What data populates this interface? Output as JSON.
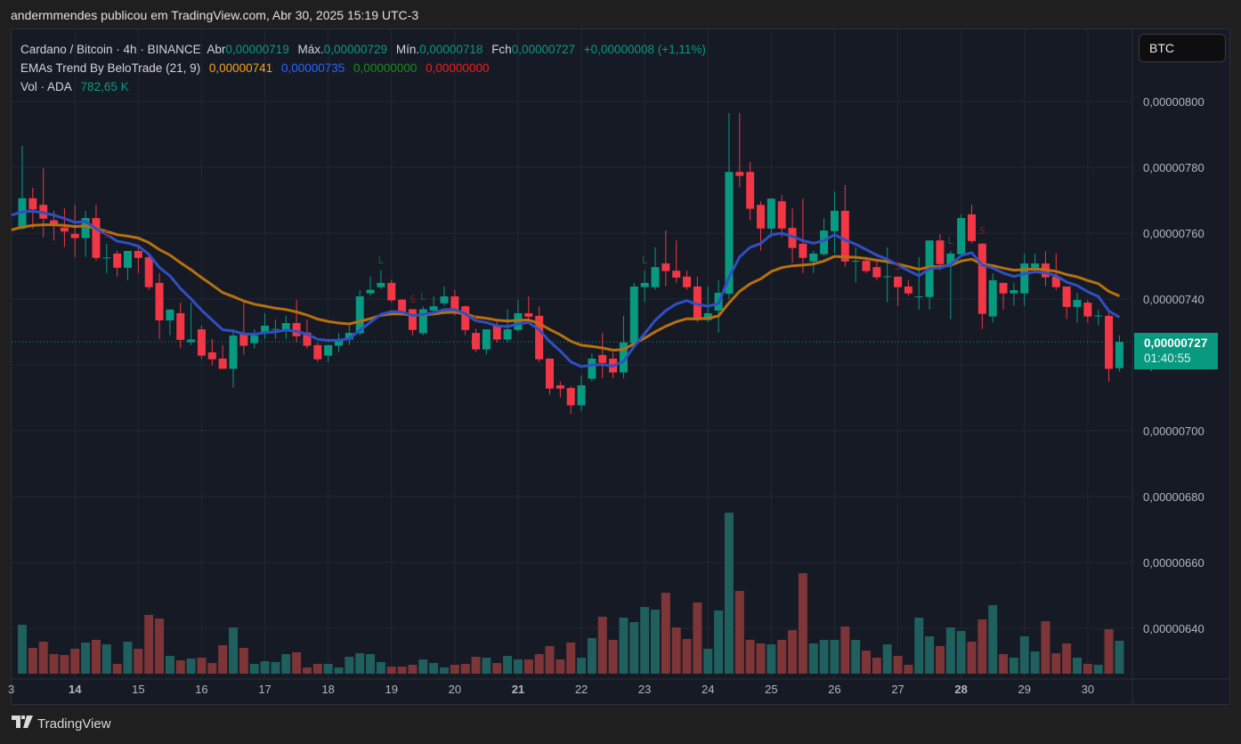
{
  "post_header": "andermmendes publicou em TradingView.com, Abr 30, 2025 15:19 UTC-3",
  "legend": {
    "symbol": "Cardano / Bitcoin · 4h · BINANCE",
    "open_label": "Abr",
    "open": "0,00000719",
    "high_label": "Máx.",
    "high": "0,00000729",
    "low_label": "Mín.",
    "low": "0,00000718",
    "close_label": "Fch",
    "close": "0,00000727",
    "change": "+0,00000008 (+1,11%)",
    "indicator": "EMAs Trend By BeloTrade (21, 9)",
    "ema_values": [
      "0,00000741",
      "0,00000735",
      "0,00000000",
      "0,00000000"
    ],
    "volume_label": "Vol · ADA",
    "volume_value": "782,65 K"
  },
  "currency_button": "BTC",
  "price_label": {
    "value": "0,00000727",
    "countdown": "01:40:55"
  },
  "footer_logo": "TradingView",
  "colors": {
    "up": "#089981",
    "down": "#f23645",
    "volume_up": "#1f5f5e",
    "volume_down": "#7e3538",
    "ema_fast": "#2f4fc4",
    "ema_slow": "#b8700f",
    "signal_long": "#0f6d1c",
    "signal_short": "#8e1b1b"
  },
  "chart_data": {
    "type": "candlestick",
    "title": "Cardano / Bitcoin · 4h · BINANCE",
    "unit_note": "prices in 1e-8 BTC (727 = 0,00000727)",
    "ylim": [
      630,
      820
    ],
    "y_ticks": [
      {
        "value": 800,
        "label": "0,00000800"
      },
      {
        "value": 780,
        "label": "0,00000780"
      },
      {
        "value": 760,
        "label": "0,00000760"
      },
      {
        "value": 740,
        "label": "0,00000740"
      },
      {
        "value": 720,
        "label": "0,00000720"
      },
      {
        "value": 700,
        "label": "0,00000700"
      },
      {
        "value": 680,
        "label": "0,00000680"
      },
      {
        "value": 660,
        "label": "0,00000660"
      },
      {
        "value": 640,
        "label": "0,00000640"
      }
    ],
    "x_ticks": [
      {
        "candle": 0,
        "label": "3",
        "bold": false
      },
      {
        "candle": 6,
        "label": "14",
        "bold": true
      },
      {
        "candle": 12,
        "label": "15",
        "bold": false
      },
      {
        "candle": 18,
        "label": "16",
        "bold": false
      },
      {
        "candle": 24,
        "label": "17",
        "bold": false
      },
      {
        "candle": 30,
        "label": "18",
        "bold": false
      },
      {
        "candle": 36,
        "label": "19",
        "bold": false
      },
      {
        "candle": 42,
        "label": "20",
        "bold": false
      },
      {
        "candle": 48,
        "label": "21",
        "bold": true
      },
      {
        "candle": 54,
        "label": "22",
        "bold": false
      },
      {
        "candle": 60,
        "label": "23",
        "bold": false
      },
      {
        "candle": 66,
        "label": "24",
        "bold": false
      },
      {
        "candle": 72,
        "label": "25",
        "bold": false
      },
      {
        "candle": 78,
        "label": "26",
        "bold": false
      },
      {
        "candle": 84,
        "label": "27",
        "bold": false
      },
      {
        "candle": 90,
        "label": "28",
        "bold": true
      },
      {
        "candle": 96,
        "label": "29",
        "bold": false
      },
      {
        "candle": 102,
        "label": "30",
        "bold": false
      }
    ],
    "candle_fields": [
      "open",
      "high",
      "low",
      "close",
      "volume_k"
    ],
    "candles": [
      [
        761.4,
        786.5,
        761,
        770.6,
        1163
      ],
      [
        770.6,
        773.8,
        761.4,
        767.2,
        613
      ],
      [
        768.6,
        779.7,
        758.7,
        764.4,
        761
      ],
      [
        763.9,
        766.8,
        757.8,
        762.5,
        465
      ],
      [
        761.7,
        767.6,
        755.8,
        760.5,
        444
      ],
      [
        759.8,
        768.6,
        752.8,
        758.5,
        592
      ],
      [
        758.5,
        766.8,
        752.8,
        764.6,
        740
      ],
      [
        764.6,
        768.6,
        751.7,
        752.5,
        804
      ],
      [
        752.5,
        756.8,
        747.9,
        752.6,
        698
      ],
      [
        753.8,
        754.7,
        746.8,
        749.5,
        233
      ],
      [
        749.5,
        754.6,
        745.8,
        754.6,
        761
      ],
      [
        754.6,
        755.8,
        747.9,
        752.5,
        592
      ],
      [
        752.7,
        753.8,
        742.8,
        743.6,
        1396
      ],
      [
        744.9,
        747.9,
        727.9,
        733.5,
        1311
      ],
      [
        733.5,
        736.8,
        729,
        736.8,
        423
      ],
      [
        735.7,
        738.9,
        725,
        727.6,
        317
      ],
      [
        726.9,
        738.9,
        726,
        727.7,
        360
      ],
      [
        730.8,
        731.9,
        721.8,
        722.8,
        381
      ],
      [
        723.8,
        727.9,
        719.8,
        721.7,
        254
      ],
      [
        721.9,
        726,
        718.8,
        718.8,
        677
      ],
      [
        718.8,
        730.8,
        713.1,
        728.9,
        1100
      ],
      [
        729.7,
        738.9,
        723.1,
        725.8,
        613
      ],
      [
        726.6,
        730.8,
        725,
        728.9,
        233
      ],
      [
        729.5,
        735.7,
        727.9,
        731.9,
        296
      ],
      [
        730.8,
        733.8,
        727.9,
        730.9,
        275
      ],
      [
        730.7,
        734.9,
        727.9,
        732.7,
        465
      ],
      [
        732.7,
        739.7,
        726.8,
        728.7,
        508
      ],
      [
        729.8,
        733.8,
        725,
        725.8,
        148
      ],
      [
        726,
        726.8,
        720.9,
        721.7,
        233
      ],
      [
        722.8,
        726,
        720.9,
        726,
        233
      ],
      [
        725.8,
        729.7,
        723.9,
        727.8,
        148
      ],
      [
        727.7,
        732.7,
        726,
        729.7,
        402
      ],
      [
        729.6,
        742.7,
        729,
        740.8,
        486
      ],
      [
        741.7,
        746.8,
        740.9,
        742.8,
        465
      ],
      [
        743.6,
        748.7,
        743,
        744.9,
        275
      ],
      [
        744.9,
        745.8,
        739,
        739.6,
        169
      ],
      [
        739.8,
        740,
        735,
        735.5,
        169
      ],
      [
        736.9,
        737,
        729,
        730.6,
        212
      ],
      [
        729.6,
        737.8,
        729,
        736.9,
        338
      ],
      [
        736.5,
        740.8,
        736,
        737.8,
        254
      ],
      [
        738.7,
        743.9,
        738,
        740.8,
        148
      ],
      [
        740.8,
        742.8,
        735,
        736.6,
        212
      ],
      [
        737.8,
        738,
        729,
        730.6,
        233
      ],
      [
        729.7,
        731,
        723.9,
        724.7,
        402
      ],
      [
        724.7,
        730.8,
        723.1,
        730.8,
        381
      ],
      [
        731.9,
        733.3,
        726.8,
        727.7,
        254
      ],
      [
        727.7,
        736.8,
        726.8,
        730.8,
        423
      ],
      [
        730.6,
        739.7,
        730,
        735.7,
        338
      ],
      [
        735.7,
        740.8,
        733.5,
        734.6,
        338
      ],
      [
        734.9,
        737.8,
        720.9,
        721.7,
        465
      ],
      [
        721.9,
        722,
        710.9,
        712.8,
        656
      ],
      [
        713.8,
        714.9,
        710.1,
        712.8,
        338
      ],
      [
        713,
        713.5,
        705,
        707.7,
        740
      ],
      [
        707.7,
        716.8,
        706,
        713.8,
        381
      ],
      [
        715.8,
        723.5,
        715,
        721.9,
        846
      ],
      [
        723,
        729.7,
        716,
        720.6,
        1354
      ],
      [
        721.9,
        723.8,
        716,
        717.7,
        804
      ],
      [
        717.7,
        734.9,
        716,
        726.8,
        1332
      ],
      [
        726.6,
        744.9,
        726,
        743.8,
        1227
      ],
      [
        743.6,
        748.7,
        738.9,
        744.9,
        1586
      ],
      [
        743.6,
        755.7,
        742.8,
        749.7,
        1523
      ],
      [
        750.8,
        760.8,
        743.9,
        748.5,
        1925
      ],
      [
        748.6,
        757.8,
        744.9,
        746.5,
        1100
      ],
      [
        746.8,
        748.6,
        742.8,
        743.6,
        825
      ],
      [
        743.8,
        746.8,
        733,
        733.6,
        1692
      ],
      [
        733.6,
        743.8,
        733,
        735.7,
        592
      ],
      [
        736.5,
        745.7,
        729.8,
        741.9,
        1502
      ],
      [
        741.6,
        796.5,
        740,
        778.6,
        3828
      ],
      [
        778.6,
        796.5,
        773.9,
        777.4,
        1967
      ],
      [
        778.6,
        781.6,
        763.9,
        767.4,
        804
      ],
      [
        768.6,
        769.7,
        754.7,
        761.4,
        719
      ],
      [
        761.4,
        770.5,
        758.7,
        770.5,
        698
      ],
      [
        769.7,
        771.6,
        758.7,
        761.4,
        804
      ],
      [
        761.6,
        767.6,
        750.9,
        755.5,
        1036
      ],
      [
        756.8,
        770.5,
        747.9,
        752.5,
        2390
      ],
      [
        751.4,
        754.6,
        747.9,
        753.8,
        719
      ],
      [
        753.6,
        764.6,
        753,
        760.8,
        804
      ],
      [
        760.6,
        772.7,
        753.9,
        766.8,
        804
      ],
      [
        766.8,
        774.6,
        749.8,
        751.4,
        1121
      ],
      [
        751.5,
        755.7,
        745,
        751.6,
        804
      ],
      [
        751.6,
        752.8,
        747.9,
        748.5,
        550
      ],
      [
        749.7,
        751.4,
        745.8,
        746.6,
        381
      ],
      [
        746.8,
        755.7,
        739,
        746.9,
        698
      ],
      [
        746.8,
        746.8,
        737.9,
        743.6,
        423
      ],
      [
        743.8,
        745.7,
        740.9,
        741.7,
        212
      ],
      [
        740.7,
        752.7,
        736.8,
        740.8,
        1332
      ],
      [
        740.6,
        757.8,
        736.8,
        757.8,
        888
      ],
      [
        757.8,
        759.7,
        748.7,
        750.6,
        656
      ],
      [
        750.4,
        754.6,
        733.9,
        753.8,
        1100
      ],
      [
        753.6,
        765.7,
        753,
        764.6,
        1015
      ],
      [
        765.7,
        768.6,
        757,
        757.6,
        761
      ],
      [
        756.8,
        757,
        730.9,
        735.5,
        1290
      ],
      [
        734.7,
        747.8,
        732.8,
        745.7,
        1629
      ],
      [
        744.9,
        745,
        736.8,
        741.7,
        465
      ],
      [
        741.7,
        744.9,
        737.9,
        742.7,
        381
      ],
      [
        741.7,
        753.8,
        737.9,
        750.8,
        888
      ],
      [
        749.5,
        753.8,
        747.9,
        750.8,
        529
      ],
      [
        750.8,
        754.6,
        743.9,
        746.6,
        1248
      ],
      [
        746.8,
        753.8,
        742.8,
        743.6,
        486
      ],
      [
        743.8,
        743.8,
        733.9,
        737.6,
        719
      ],
      [
        737.6,
        741.9,
        732.8,
        739.7,
        381
      ],
      [
        738.9,
        739.7,
        732.8,
        734.7,
        233
      ],
      [
        734.9,
        736.8,
        732,
        735,
        212
      ],
      [
        734.9,
        735.8,
        714.9,
        718.8,
        1058
      ],
      [
        719,
        729,
        718,
        727,
        782.65
      ]
    ],
    "ema": {
      "fast_period": 9,
      "slow_period": 21,
      "fast_seed": 765.5,
      "slow_seed": 761
    },
    "signals": [
      {
        "candle": 9,
        "type": "S",
        "price": 759.7
      },
      {
        "candle": 35,
        "type": "L",
        "price": 751.9
      },
      {
        "candle": 38,
        "type": "S",
        "price": 740
      },
      {
        "candle": 39,
        "type": "L",
        "price": 740.8
      },
      {
        "candle": 44,
        "type": "S",
        "price": 734.1
      },
      {
        "candle": 60,
        "type": "L",
        "price": 751.9
      },
      {
        "candle": 84,
        "type": "S",
        "price": 750
      },
      {
        "candle": 89,
        "type": "L",
        "price": 757.8
      },
      {
        "candle": 92,
        "type": "S",
        "price": 760.8
      }
    ],
    "last_price": 727
  }
}
